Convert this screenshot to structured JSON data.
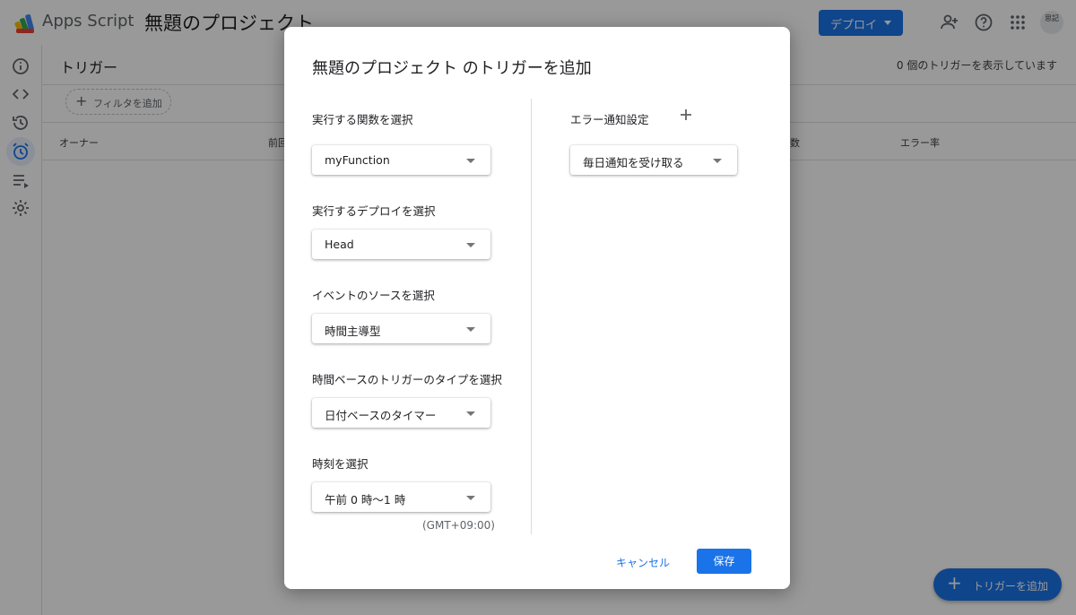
{
  "app": {
    "name": "Apps Script",
    "project_title": "無題のプロジェクト",
    "deploy_label": "デプロイ",
    "avatar_text": "思記"
  },
  "page": {
    "title": "トリガー",
    "count_text": "0 個のトリガーを表示しています",
    "filter_label": "フィルタを追加",
    "columns": [
      "オーナー",
      "前回",
      "数",
      "エラー率"
    ],
    "fab_label": "トリガーを追加"
  },
  "sidebar": {
    "items": [
      {
        "icon": "info-icon"
      },
      {
        "icon": "code-icon"
      },
      {
        "icon": "history-icon"
      },
      {
        "icon": "alarm-icon",
        "active": true
      },
      {
        "icon": "executions-icon"
      },
      {
        "icon": "gear-icon"
      }
    ]
  },
  "dialog": {
    "title": "無題のプロジェクト のトリガーを追加",
    "fields": [
      {
        "label": "実行する関数を選択",
        "value": "myFunction"
      },
      {
        "label": "実行するデプロイを選択",
        "value": "Head"
      },
      {
        "label": "イベントのソースを選択",
        "value": "時間主導型"
      },
      {
        "label": "時間ベースのトリガーのタイプを選択",
        "value": "日付ベースのタイマー"
      },
      {
        "label": "時刻を選択",
        "value": "午前 0 時〜1 時"
      }
    ],
    "timezone_note": "(GMT+09:00)",
    "error_notification": {
      "label": "エラー通知設定",
      "value": "毎日通知を受け取る"
    },
    "cancel_label": "キャンセル",
    "save_label": "保存"
  },
  "colors": {
    "accent": "#1a73e8",
    "scrim": "rgba(0,0,0,0.40)"
  }
}
